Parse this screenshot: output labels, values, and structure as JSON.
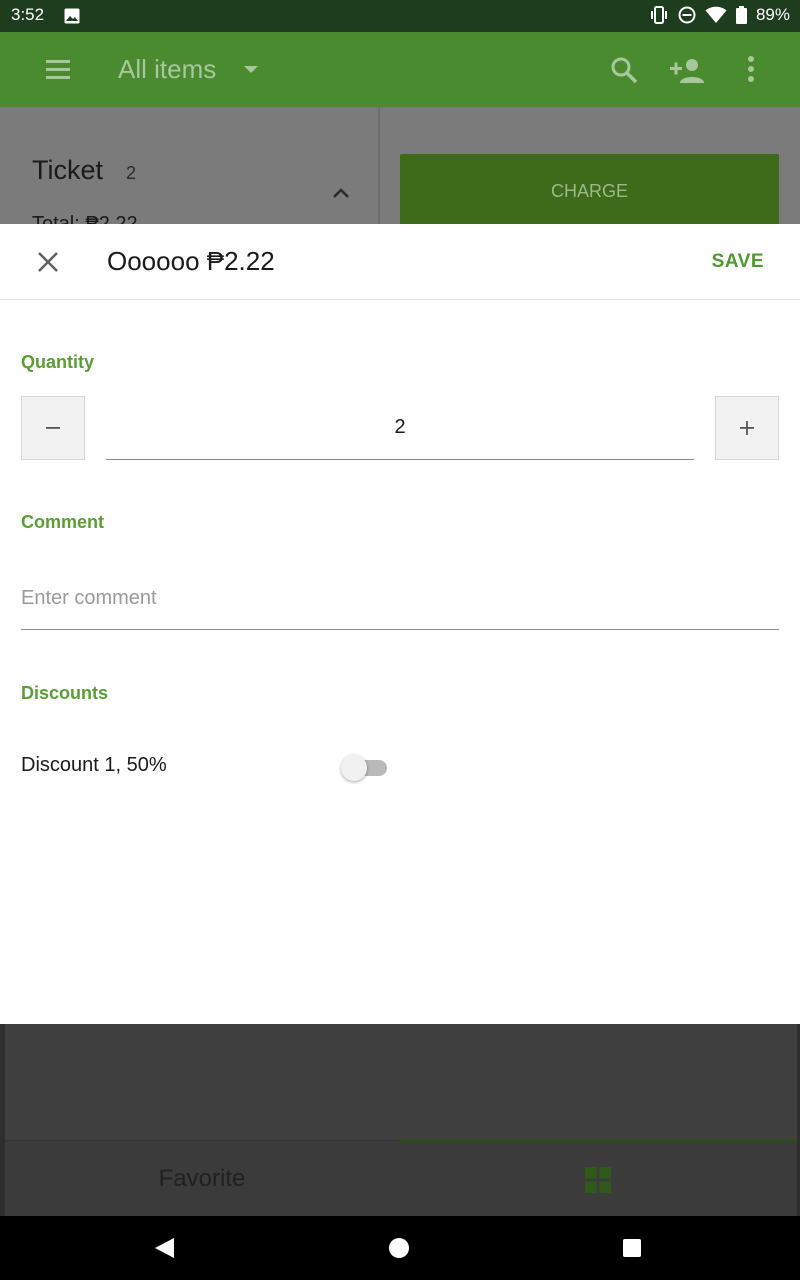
{
  "status_bar": {
    "time": "3:52",
    "battery": "89%",
    "icons": [
      "image-icon",
      "vibrate-icon",
      "dnd-icon",
      "wifi-icon",
      "battery-icon"
    ]
  },
  "toolbar": {
    "title": "All items",
    "icons": [
      "menu-icon",
      "search-icon",
      "add-customer-icon",
      "more-vert-icon"
    ]
  },
  "ticket": {
    "title": "Ticket",
    "count": "2",
    "total": "Total: ₱2.22",
    "charge_label": "CHARGE"
  },
  "dialog": {
    "title": "Oooooo ₱2.22",
    "save_label": "SAVE",
    "quantity_label": "Quantity",
    "quantity_value": "2",
    "minus_glyph": "–",
    "plus_glyph": "+",
    "comment_label": "Comment",
    "comment_placeholder": "Enter comment",
    "comment_value": "",
    "discounts_label": "Discounts",
    "discounts": [
      {
        "label": "Discount 1, 50%",
        "enabled": false
      }
    ]
  },
  "bottom_tabs": {
    "favorite_label": "Favorite"
  },
  "colors": {
    "accent": "#4f9a2e",
    "toolbar": "#4a8b30",
    "status_bar": "#1e3c1e"
  }
}
